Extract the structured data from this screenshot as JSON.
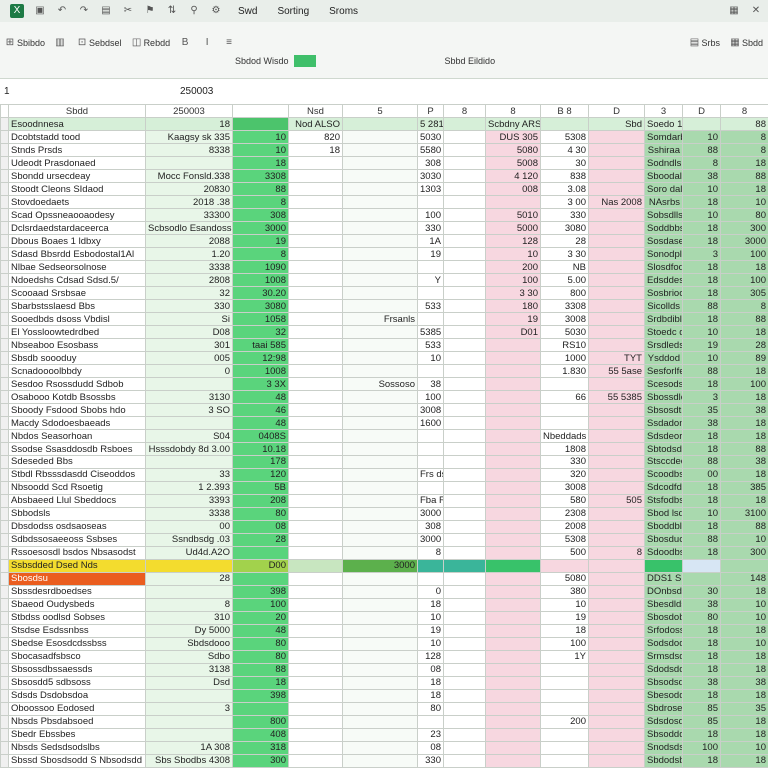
{
  "ribbon": {
    "tabs": [
      "Swd",
      "Sorting",
      "Sroms"
    ],
    "row2": [
      "Sbibdo",
      "Sebdsel",
      "Rebdd",
      "Srbs",
      "Sbdd"
    ],
    "row3": [
      "Sbdod Wisdo",
      "Sbbd Eildido"
    ]
  },
  "formula_bar": {
    "name_box": "1",
    "formula": "250003"
  },
  "columns": [
    "",
    "Sbdd",
    "250003",
    "",
    "Nsd",
    "5",
    "P",
    "8",
    "8",
    "B  8",
    "D",
    "3",
    "D",
    "8"
  ],
  "rows": [
    [
      "Esoodnnesa",
      "18",
      "",
      "Nod ALSO",
      "",
      "5 281",
      "Scbdny ARS",
      "",
      "Sbd",
      "Soedo 10",
      "",
      "88"
    ],
    [
      "Dcobtstadd tood",
      "Kaagsy sk 335",
      "10",
      "820",
      "",
      "5030",
      "DUS 305",
      "5308",
      "",
      "Somdarbs",
      "10",
      "8"
    ],
    [
      "Stnds Prsds",
      "8338",
      "10",
      "18",
      "",
      "5580",
      "5080",
      "4 30",
      "",
      "Sshiraa",
      "88",
      "8"
    ],
    [
      "Udeodt Prasdonaed",
      "",
      "18",
      "",
      "",
      "308",
      "5008",
      "30",
      "",
      "Sodndls",
      "8",
      "18"
    ],
    [
      "Sbondd ursecdeay",
      "Mocc Fonsld.338",
      "3308",
      "",
      "",
      "3030",
      "4 120",
      "838",
      "",
      "Sboodalla",
      "38",
      "88"
    ],
    [
      "Stoodt Cleons SIdaod",
      "20830",
      "88",
      "",
      "",
      "1303",
      "008",
      "3.08",
      "",
      "Soro dals",
      "10",
      "18"
    ],
    [
      "Stovdoedaets",
      "2018 .38",
      "8",
      "",
      "",
      "",
      "",
      "3 00",
      "Nas 2008",
      "NAsrbs",
      "18",
      "10"
    ],
    [
      "Scad Opssneaooaodesy",
      "33300",
      "308",
      "",
      "",
      "100",
      "5010",
      "330",
      "",
      "Sobsdlls",
      "10",
      "80"
    ],
    [
      "Dclsrdaedstardaceerca",
      "Scbsodlo Esandoss",
      "3000",
      "",
      "",
      "330",
      "5000",
      "3080",
      "",
      "Soddbbs",
      "18",
      "300"
    ],
    [
      "Dbous Boaes 1 ldbxy",
      "2088",
      "19",
      "",
      "",
      "1A",
      "128",
      "28",
      "",
      "Sosdaseo",
      "18",
      "3000"
    ],
    [
      "Sdasd Bbsrdd Esbodostal1Al",
      "1.20",
      "8",
      "",
      "",
      "19",
      "10",
      "3 30",
      "",
      "Sonodpleo",
      "3",
      "100"
    ],
    [
      "Nlbae Sedseorsolnose",
      "3338",
      "1090",
      "",
      "",
      "",
      "200",
      "NB",
      "",
      "Slosdfodbo",
      "18",
      "18"
    ],
    [
      "Ndoedshs Cdsad Sdsd.5/",
      "2808",
      "1008",
      "",
      "",
      "Y",
      "100",
      "5.00",
      "",
      "Edsddesd",
      "18",
      "100"
    ],
    [
      "Scooaad Srsbsae",
      "32",
      "30.20",
      "",
      "",
      "",
      "3 30",
      "800",
      "",
      "Sosbrioods",
      "18",
      "305"
    ],
    [
      "Sbarbstsslaesd Bbs",
      "330",
      "3080",
      "",
      "",
      "533",
      "180",
      "3308",
      "",
      "Sicollds",
      "88",
      "8"
    ],
    [
      "Sooedbds dsoss Vbdisl",
      "Si",
      "1058",
      "",
      "Frsanls",
      "",
      "19",
      "3008",
      "",
      "Srdbdiblac",
      "18",
      "88"
    ],
    [
      "El Yossloowtedrdbed",
      "D08",
      "32",
      "",
      "",
      "5385",
      "D01",
      "5030",
      "",
      "Stoedc dids",
      "10",
      "18"
    ],
    [
      "Nbseaboo Esosbass",
      "301",
      "taai 585",
      "",
      "",
      "533",
      "",
      "RS10",
      "",
      "Srsdleds",
      "19",
      "28"
    ],
    [
      "Sbsdb soooduy",
      "005",
      "12:98",
      "",
      "",
      "10",
      "",
      "1000",
      "TYT",
      "Ysddod",
      "10",
      "89"
    ],
    [
      "Scnadoooolbbdy",
      "0",
      "1008",
      "",
      "",
      "",
      "",
      "1.830",
      "55 5ase",
      "Sesforlfe",
      "88",
      "18"
    ],
    [
      "Sesdoo Rsossdudd Sdbob",
      "",
      "3 3X",
      "",
      "Sossoso",
      "38",
      "",
      "",
      "",
      "Scesodsse",
      "18",
      "100"
    ],
    [
      "Osabooo Kotdb Bsossbs",
      "3130",
      "48",
      "",
      "",
      "100",
      "",
      "66",
      "55 5385",
      "Sbossdles",
      "3",
      "18"
    ],
    [
      "Sboody Fsdood Sbobs hdo",
      "3 SO",
      "46",
      "",
      "",
      "3008",
      "",
      "",
      "",
      "Sbsosdt",
      "35",
      "38"
    ],
    [
      "Macdy Sdodoesbaeads",
      "",
      "48",
      "",
      "",
      "1600",
      "",
      "",
      "",
      "Ssdadonno",
      "38",
      "18"
    ],
    [
      "Nbdos Seasorhoan",
      "S04",
      "0408S",
      "",
      "",
      "",
      "",
      "Nbeddads",
      "",
      "Sdsdeorbs",
      "18",
      "18"
    ],
    [
      "Ssodse Ssasddosdb Rsboes",
      "Hsssdobdy 8d 3.00",
      "10.18",
      "",
      "",
      "",
      "",
      "1808",
      "",
      "Sbtodsdls",
      "18",
      "88"
    ],
    [
      "Sdeseded Bbs",
      "",
      "178",
      "",
      "",
      "",
      "",
      "330",
      "",
      "Stsccdees",
      "88",
      "38"
    ],
    [
      "Stbdl Rbsssdasdd Ciseoddos",
      "33",
      "120",
      "",
      "",
      "Frs dssdes",
      "",
      "320",
      "",
      "Scoodbss",
      "00",
      "18"
    ],
    [
      "Nbsoodd Scd Rsoetig",
      "1 2.393",
      "5B",
      "",
      "",
      "",
      "",
      "3008",
      "",
      "Sdcodfds",
      "18",
      "385"
    ],
    [
      "Absbaeed Llul Sbeddocs",
      "3393",
      "208",
      "",
      "",
      "Fba Rsbss38",
      "",
      "580",
      "505",
      "Stsfodbsd",
      "18",
      "18"
    ],
    [
      "Sbbodsls",
      "3338",
      "80",
      "",
      "",
      "3000",
      "",
      "2308",
      "",
      "Sbod lsdls",
      "10",
      "3100"
    ],
    [
      "Dbsdodss osdsaoseas",
      "00",
      "08",
      "",
      "",
      "308",
      "",
      "2008",
      "",
      "Sboddbldbes",
      "18",
      "88"
    ],
    [
      "Sdbdssosaeeoss Ssbses",
      "Ssndbsdg .03",
      "28",
      "",
      "",
      "3000",
      "",
      "5308",
      "",
      "Sbosduoss",
      "88",
      "10"
    ],
    [
      "Rssoesosdl bsdos Nbsasodst",
      "Ud4d.A2O",
      "",
      "",
      "",
      "8",
      "",
      "500",
      "8",
      "Sdoodbsss",
      "18",
      "300"
    ],
    [
      "Ssbsdded Dsed Nds",
      "",
      "D00",
      "",
      "3000",
      "",
      "",
      "",
      "",
      "",
      "",
      ""
    ],
    [
      "Sbosdsu",
      "28",
      "",
      "",
      "",
      "",
      "",
      "5080",
      "",
      "DDS1 Sbs",
      "",
      "148"
    ],
    [
      "Sbssdesrdboedses",
      "",
      "398",
      "",
      "",
      "0",
      "",
      "380",
      "",
      "DOnbsd",
      "30",
      "18"
    ],
    [
      "Sbaeod Oudysbeds",
      "8",
      "100",
      "",
      "",
      "18",
      "",
      "10",
      "",
      "Sbesdldss",
      "38",
      "10"
    ],
    [
      "Stbdss oodlsd Sobses",
      "310",
      "20",
      "",
      "",
      "10",
      "",
      "19",
      "",
      "Sbosdobs",
      "80",
      "10"
    ],
    [
      "Stsdse Esdssnbss",
      "Dy 5000",
      "48",
      "",
      "",
      "19",
      "",
      "18",
      "",
      "Srfodoss",
      "18",
      "18"
    ],
    [
      "Sbedse Esosdcdssbss",
      "Sbdsdooo",
      "80",
      "",
      "",
      "10",
      "",
      "100",
      "",
      "Sodsdodsb",
      "18",
      "10"
    ],
    [
      "Sbocasadfsbsco",
      "Sdbo",
      "80",
      "",
      "",
      "128",
      "",
      "1Y",
      "",
      "Srmsdsdds",
      "18",
      "18"
    ],
    [
      "Sbsossdbssaessds",
      "3138",
      "88",
      "",
      "",
      "08",
      "",
      "",
      "",
      "Sdodsddsbs",
      "18",
      "18"
    ],
    [
      "Sbsosdd5 sdbsoss",
      "Dsd",
      "18",
      "",
      "",
      "18",
      "",
      "",
      "",
      "Sbsodsdds",
      "38",
      "38"
    ],
    [
      "Sdsds Dsdobsdoa",
      "",
      "398",
      "",
      "",
      "18",
      "",
      "",
      "",
      "Sbesoddss",
      "18",
      "18"
    ],
    [
      "Oboossoo Eodosed",
      "3",
      "",
      "",
      "",
      "80",
      "",
      "",
      "",
      "Sbdrosess",
      "85",
      "35"
    ],
    [
      "Nbsds Pbsdabsoed",
      "",
      "800",
      "",
      "",
      "",
      "",
      "200",
      "",
      "Sdsdosdbs",
      "85",
      "18"
    ],
    [
      "Sbedr Ebssbes",
      "",
      "408",
      "",
      "",
      "23",
      "",
      "",
      "",
      "Sbsodddss",
      "18",
      "18"
    ],
    [
      "Nbsds Sedsdsodslbs",
      "1A 308",
      "318",
      "",
      "",
      "08",
      "",
      "",
      "",
      "Snodsdss",
      "100",
      "10"
    ],
    [
      "Sbssd Sbosdsodd S Nbsodsdd",
      "Sbs Sbodbs 4308",
      "300",
      "",
      "",
      "330",
      "",
      "",
      "",
      "Sbdodsbss",
      "18",
      "18"
    ]
  ]
}
